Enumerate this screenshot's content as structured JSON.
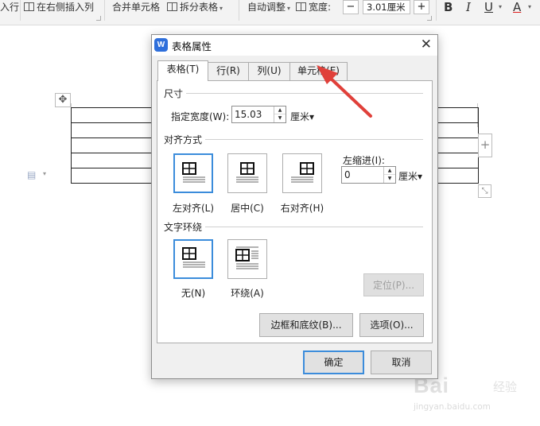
{
  "ribbon": {
    "insert_row_partial": "入行",
    "insert_right": "在右侧插入列",
    "merge_cells": "合并单元格",
    "split_table": "拆分表格",
    "auto_fit": "自动调整",
    "width_label": "宽度:",
    "width_value": "3.01厘米",
    "minus": "−",
    "plus": "+",
    "bold": "B",
    "italic": "I",
    "underline": "U",
    "font_color": "A"
  },
  "document": {
    "table": {
      "rows": 5,
      "cols": 1
    },
    "move_handle": "✥",
    "add_column": "+",
    "resize": "⤡"
  },
  "dialog": {
    "title": "表格属性",
    "app_icon": "W",
    "close": "✕",
    "tabs": [
      {
        "label": "表格(T)",
        "active": true
      },
      {
        "label": "行(R)",
        "active": false
      },
      {
        "label": "列(U)",
        "active": false
      },
      {
        "label": "单元格(E)",
        "active": false
      }
    ],
    "size": {
      "section": "尺寸",
      "width_label": "指定宽度(W):",
      "width_value": "15.03",
      "unit": "厘米▾"
    },
    "alignment": {
      "section": "对齐方式",
      "options": [
        {
          "label": "左对齐(L)",
          "selected": true,
          "icon": "align-left-icon"
        },
        {
          "label": "居中(C)",
          "selected": false,
          "icon": "align-center-icon"
        },
        {
          "label": "右对齐(H)",
          "selected": false,
          "icon": "align-right-icon"
        }
      ],
      "indent_label": "左缩进(I):",
      "indent_value": "0",
      "indent_unit": "厘米▾"
    },
    "wrapping": {
      "section": "文字环绕",
      "options": [
        {
          "label": "无(N)",
          "selected": true,
          "icon": "wrap-none-icon"
        },
        {
          "label": "环绕(A)",
          "selected": false,
          "icon": "wrap-around-icon"
        }
      ],
      "position_button": "定位(P)..."
    },
    "borders_button": "边框和底纹(B)...",
    "options_button": "选项(O)...",
    "ok_button": "确定",
    "cancel_button": "取消"
  },
  "watermark": {
    "brand": "Bai",
    "brand_suffix": "经验",
    "url": "jingyan.baidu.com"
  },
  "colors": {
    "selection_blue": "#3b8cdb",
    "annotation_red": "#e0403a",
    "app_icon_blue": "#2f6fdb"
  }
}
